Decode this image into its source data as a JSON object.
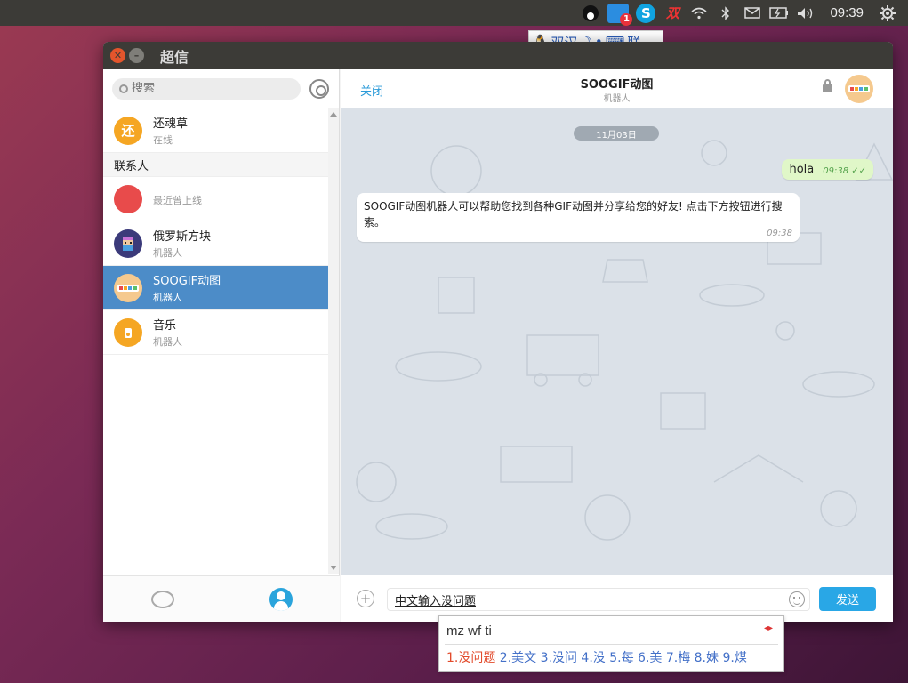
{
  "topbar": {
    "app_badge": "1",
    "skype_letter": "S",
    "shuang_label": "双",
    "time": "09:39"
  },
  "ime_status": {
    "text": "双汉",
    "suffix": "联"
  },
  "window": {
    "title": "超信"
  },
  "sidebar": {
    "search_placeholder": "搜索",
    "pinned": {
      "avatar_text": "还",
      "avatar_color": "#f5a623",
      "name": "还魂草",
      "status": "在线"
    },
    "section_label": "联系人",
    "contacts": [
      {
        "avatar_text": "",
        "avatar_color": "#e84b4b",
        "name": "",
        "status": "最近曾上线",
        "active": false
      },
      {
        "avatar_text": "",
        "avatar_color": "#3b3a7a",
        "name": "俄罗斯方块",
        "status": "机器人",
        "active": false
      },
      {
        "avatar_text": "",
        "avatar_color": "#f5c98e",
        "name": "SOOGIF动图",
        "status": "机器人",
        "active": true
      },
      {
        "avatar_text": "",
        "avatar_color": "#f5a623",
        "name": "音乐",
        "status": "机器人",
        "active": false
      }
    ]
  },
  "chat": {
    "close_label": "关闭",
    "title": "SOOGIF动图",
    "subtitle": "机器人",
    "date_label": "11月03日",
    "outgoing": {
      "text": "hola",
      "time": "09:38 ✓✓"
    },
    "incoming": {
      "text": "SOOGIF动图机器人可以帮助您找到各种GIF动图并分享给您的好友! 点击下方按钮进行搜索。",
      "time": "09:38"
    },
    "composer": {
      "plus_label": "+",
      "input_value": "中文输入没问题",
      "send_label": "发送"
    }
  },
  "ime_popup": {
    "preedit": "mz wf ti",
    "arrows": "◂▸",
    "first_candidate": "1.没问题",
    "other_candidates": " 2.美文 3.没问 4.没 5.每 6.美 7.梅 8.妹 9.煤"
  },
  "colors": {
    "accent": "#29a7e6",
    "selected_row": "#4c8cc8",
    "chat_background": "#dbe1e8",
    "outgoing_bubble": "#e0f7c8"
  }
}
